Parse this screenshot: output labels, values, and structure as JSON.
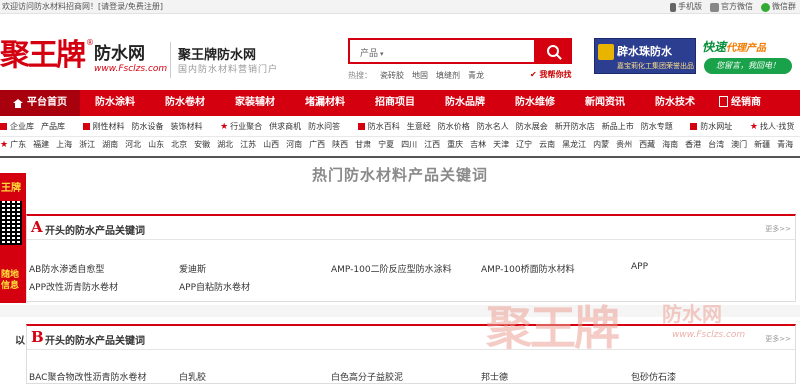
{
  "topbar": {
    "welcome": "欢迎访问防水材料招商网！",
    "login": "[请登录/免费注册]",
    "mobile": "手机版",
    "wechat_official": "官方微信",
    "wechat": "微信群"
  },
  "header": {
    "logo_text": "聚王牌",
    "logo_reg": "®",
    "logo_sub": "防水网",
    "logo_url": "www.Fsclzs.com",
    "brand_title": "聚王牌防水网",
    "brand_sub": "国内防水材料营销门户",
    "search_category": "产品",
    "search_placeholder": "",
    "hot_label": "热搜：",
    "hot_words": [
      "瓷砖胶",
      "地固",
      "填缝剂",
      "青龙"
    ],
    "find_button": "✔ 我帮你找",
    "ad1_title": "辟水珠防水",
    "ad1_sub": "嘉宝莉化工集团荣誉出品",
    "ad2_title": "快速",
    "ad2_title_b": "代理产品",
    "ad2_sub": "您留言，我回电！"
  },
  "nav": {
    "items": [
      "平台首页",
      "防水涂料",
      "防水卷材",
      "家装辅材",
      "堵漏材料",
      "招商项目",
      "防水品牌",
      "防水维修",
      "新闻资讯",
      "防水技术",
      "经销商"
    ]
  },
  "subnav": {
    "group1": [
      "企业库",
      "产品库"
    ],
    "group2": [
      "刚性材料",
      "防水设备",
      "装饰材料"
    ],
    "group3": [
      "行业聚合",
      "供求商机",
      "防水问答"
    ],
    "group4": [
      "防水百科",
      "生意经",
      "防水价格",
      "防水名人",
      "防水展会",
      "新开防水店",
      "新品上市",
      "防水专题"
    ],
    "group5": [
      "防水网址"
    ],
    "group6": [
      "找人·找货"
    ]
  },
  "regions": [
    "广东",
    "福建",
    "上海",
    "浙江",
    "湖南",
    "河北",
    "山东",
    "北京",
    "安徽",
    "湖北",
    "江苏",
    "山西",
    "河南",
    "广西",
    "陕西",
    "甘肃",
    "宁夏",
    "四川",
    "江西",
    "重庆",
    "吉林",
    "天津",
    "辽宁",
    "云南",
    "黑龙江",
    "内蒙",
    "贵州",
    "西藏",
    "海南",
    "香港",
    "台湾",
    "澳门",
    "新疆",
    "青海"
  ],
  "side": {
    "top": "王牌",
    "bottom": "随地信息"
  },
  "page_title": "热门防水材料产品关键词",
  "sections": [
    {
      "letter": "A",
      "pre": "",
      "title": "开头的防水产品关键词",
      "more": "更多>>",
      "keywords": [
        "AB防水渗透自愈型",
        "爱迪斯",
        "AMP-100二阶反应型防水涂料",
        "AMP-100桥面防水材料",
        "APP",
        "APP改性沥青防水卷材",
        "APP自粘防水卷材"
      ]
    },
    {
      "letter": "B",
      "pre": "以",
      "title": "开头的防水产品关键词",
      "more": "更多>>",
      "keywords": [
        "BAC聚合物改性沥青防水卷材",
        "白乳胶",
        "白色高分子益胶泥",
        "邦士德",
        "包砂仿石漆"
      ]
    }
  ],
  "watermark": {
    "big": "聚王牌",
    "small": "防水网",
    "url": "www.Fsclzs.com"
  }
}
